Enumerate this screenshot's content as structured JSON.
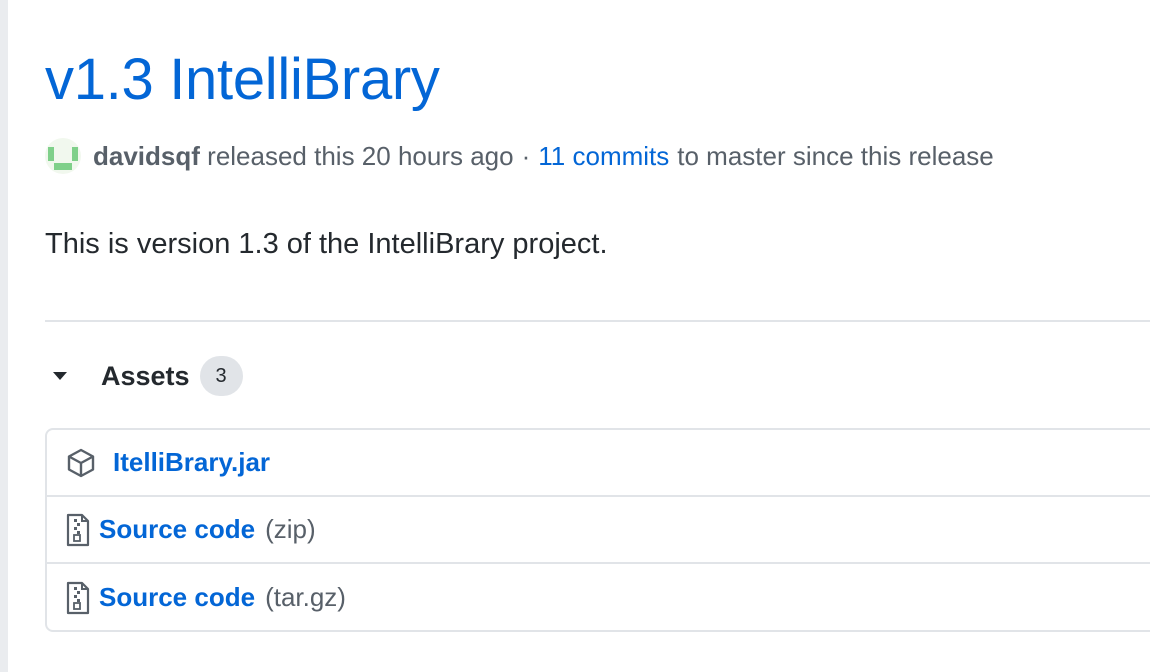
{
  "release": {
    "title": "v1.3 IntelliBrary",
    "author": "davidsqf",
    "released_text": "released this 20 hours ago",
    "separator": "·",
    "commits_link": "11 commits",
    "commits_suffix": "to master since this release",
    "description": "This is version 1.3 of the IntelliBrary project."
  },
  "assets": {
    "label": "Assets",
    "count": "3",
    "items": [
      {
        "name": "ItelliBrary.jar",
        "ext": "",
        "icon": "package-icon"
      },
      {
        "name": "Source code",
        "ext": "(zip)",
        "icon": "file-zip-icon"
      },
      {
        "name": "Source code",
        "ext": "(tar.gz)",
        "icon": "file-zip-icon"
      }
    ]
  },
  "colors": {
    "link": "#0366d6",
    "text": "#24292e",
    "muted": "#586069",
    "border": "#e1e4e8"
  }
}
